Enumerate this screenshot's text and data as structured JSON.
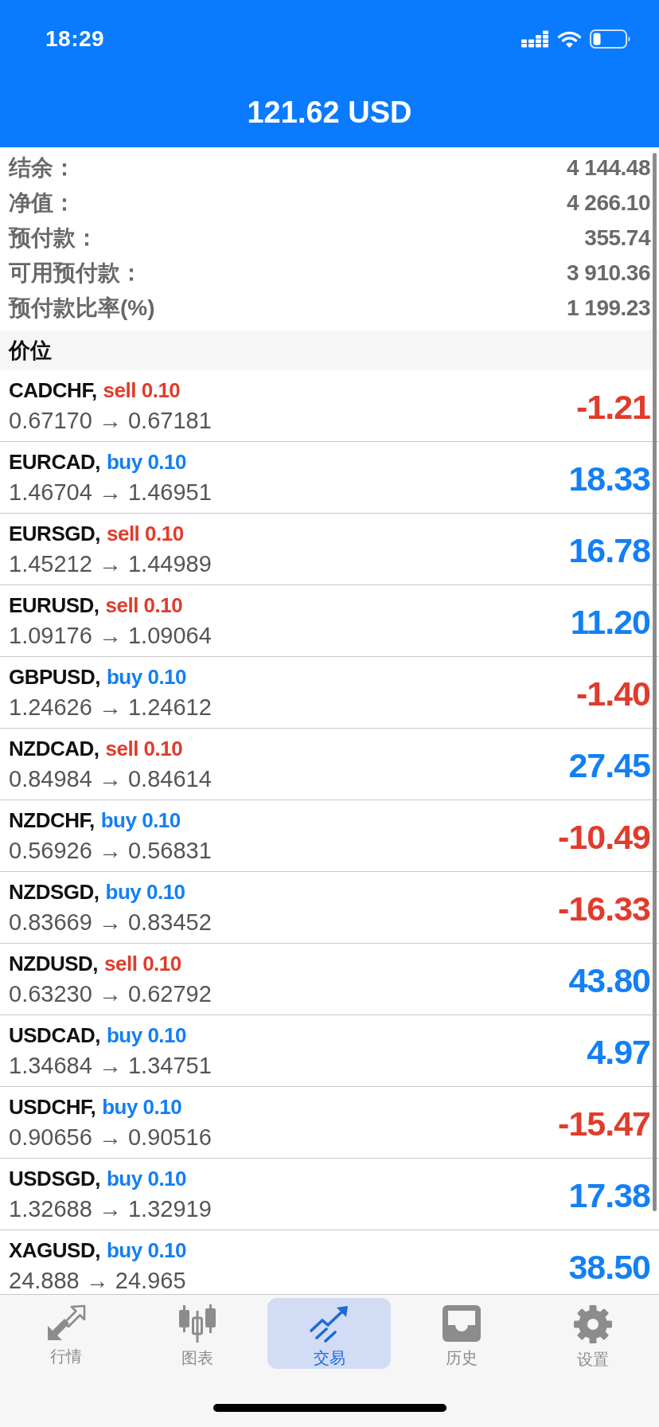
{
  "status_bar": {
    "time": "18:29"
  },
  "header": {
    "title": "121.62 USD"
  },
  "summary": [
    {
      "label": "结余：",
      "value": "4 144.48"
    },
    {
      "label": "净值：",
      "value": "4 266.10"
    },
    {
      "label": "预付款：",
      "value": "355.74"
    },
    {
      "label": "可用预付款：",
      "value": "3 910.36"
    },
    {
      "label": "预付款比率(%)",
      "value": "1 199.23"
    }
  ],
  "section": {
    "title": "价位"
  },
  "positions": [
    {
      "symbol": "CADCHF,",
      "order": "sell 0.10",
      "kind": "sell",
      "prices": "0.67170 → 0.67181",
      "profit": "-1.21",
      "loss": true
    },
    {
      "symbol": "EURCAD,",
      "order": "buy 0.10",
      "kind": "buy",
      "prices": "1.46704 → 1.46951",
      "profit": "18.33",
      "loss": false
    },
    {
      "symbol": "EURSGD,",
      "order": "sell 0.10",
      "kind": "sell",
      "prices": "1.45212 → 1.44989",
      "profit": "16.78",
      "loss": false
    },
    {
      "symbol": "EURUSD,",
      "order": "sell 0.10",
      "kind": "sell",
      "prices": "1.09176 → 1.09064",
      "profit": "11.20",
      "loss": false
    },
    {
      "symbol": "GBPUSD,",
      "order": "buy 0.10",
      "kind": "buy",
      "prices": "1.24626 → 1.24612",
      "profit": "-1.40",
      "loss": true
    },
    {
      "symbol": "NZDCAD,",
      "order": "sell 0.10",
      "kind": "sell",
      "prices": "0.84984 → 0.84614",
      "profit": "27.45",
      "loss": false
    },
    {
      "symbol": "NZDCHF,",
      "order": "buy 0.10",
      "kind": "buy",
      "prices": "0.56926 → 0.56831",
      "profit": "-10.49",
      "loss": true
    },
    {
      "symbol": "NZDSGD,",
      "order": "buy 0.10",
      "kind": "buy",
      "prices": "0.83669 → 0.83452",
      "profit": "-16.33",
      "loss": true
    },
    {
      "symbol": "NZDUSD,",
      "order": "sell 0.10",
      "kind": "sell",
      "prices": "0.63230 → 0.62792",
      "profit": "43.80",
      "loss": false
    },
    {
      "symbol": "USDCAD,",
      "order": "buy 0.10",
      "kind": "buy",
      "prices": "1.34684 → 1.34751",
      "profit": "4.97",
      "loss": false
    },
    {
      "symbol": "USDCHF,",
      "order": "buy 0.10",
      "kind": "buy",
      "prices": "0.90656 → 0.90516",
      "profit": "-15.47",
      "loss": true
    },
    {
      "symbol": "USDSGD,",
      "order": "buy 0.10",
      "kind": "buy",
      "prices": "1.32688 → 1.32919",
      "profit": "17.38",
      "loss": false
    },
    {
      "symbol": "XAGUSD,",
      "order": "buy 0.10",
      "kind": "buy",
      "prices": "24.888 → 24.965",
      "profit": "38.50",
      "loss": false
    }
  ],
  "tabs": [
    {
      "label": "行情",
      "selected": false
    },
    {
      "label": "图表",
      "selected": false
    },
    {
      "label": "交易",
      "selected": true
    },
    {
      "label": "历史",
      "selected": false
    },
    {
      "label": "设置",
      "selected": false
    }
  ]
}
